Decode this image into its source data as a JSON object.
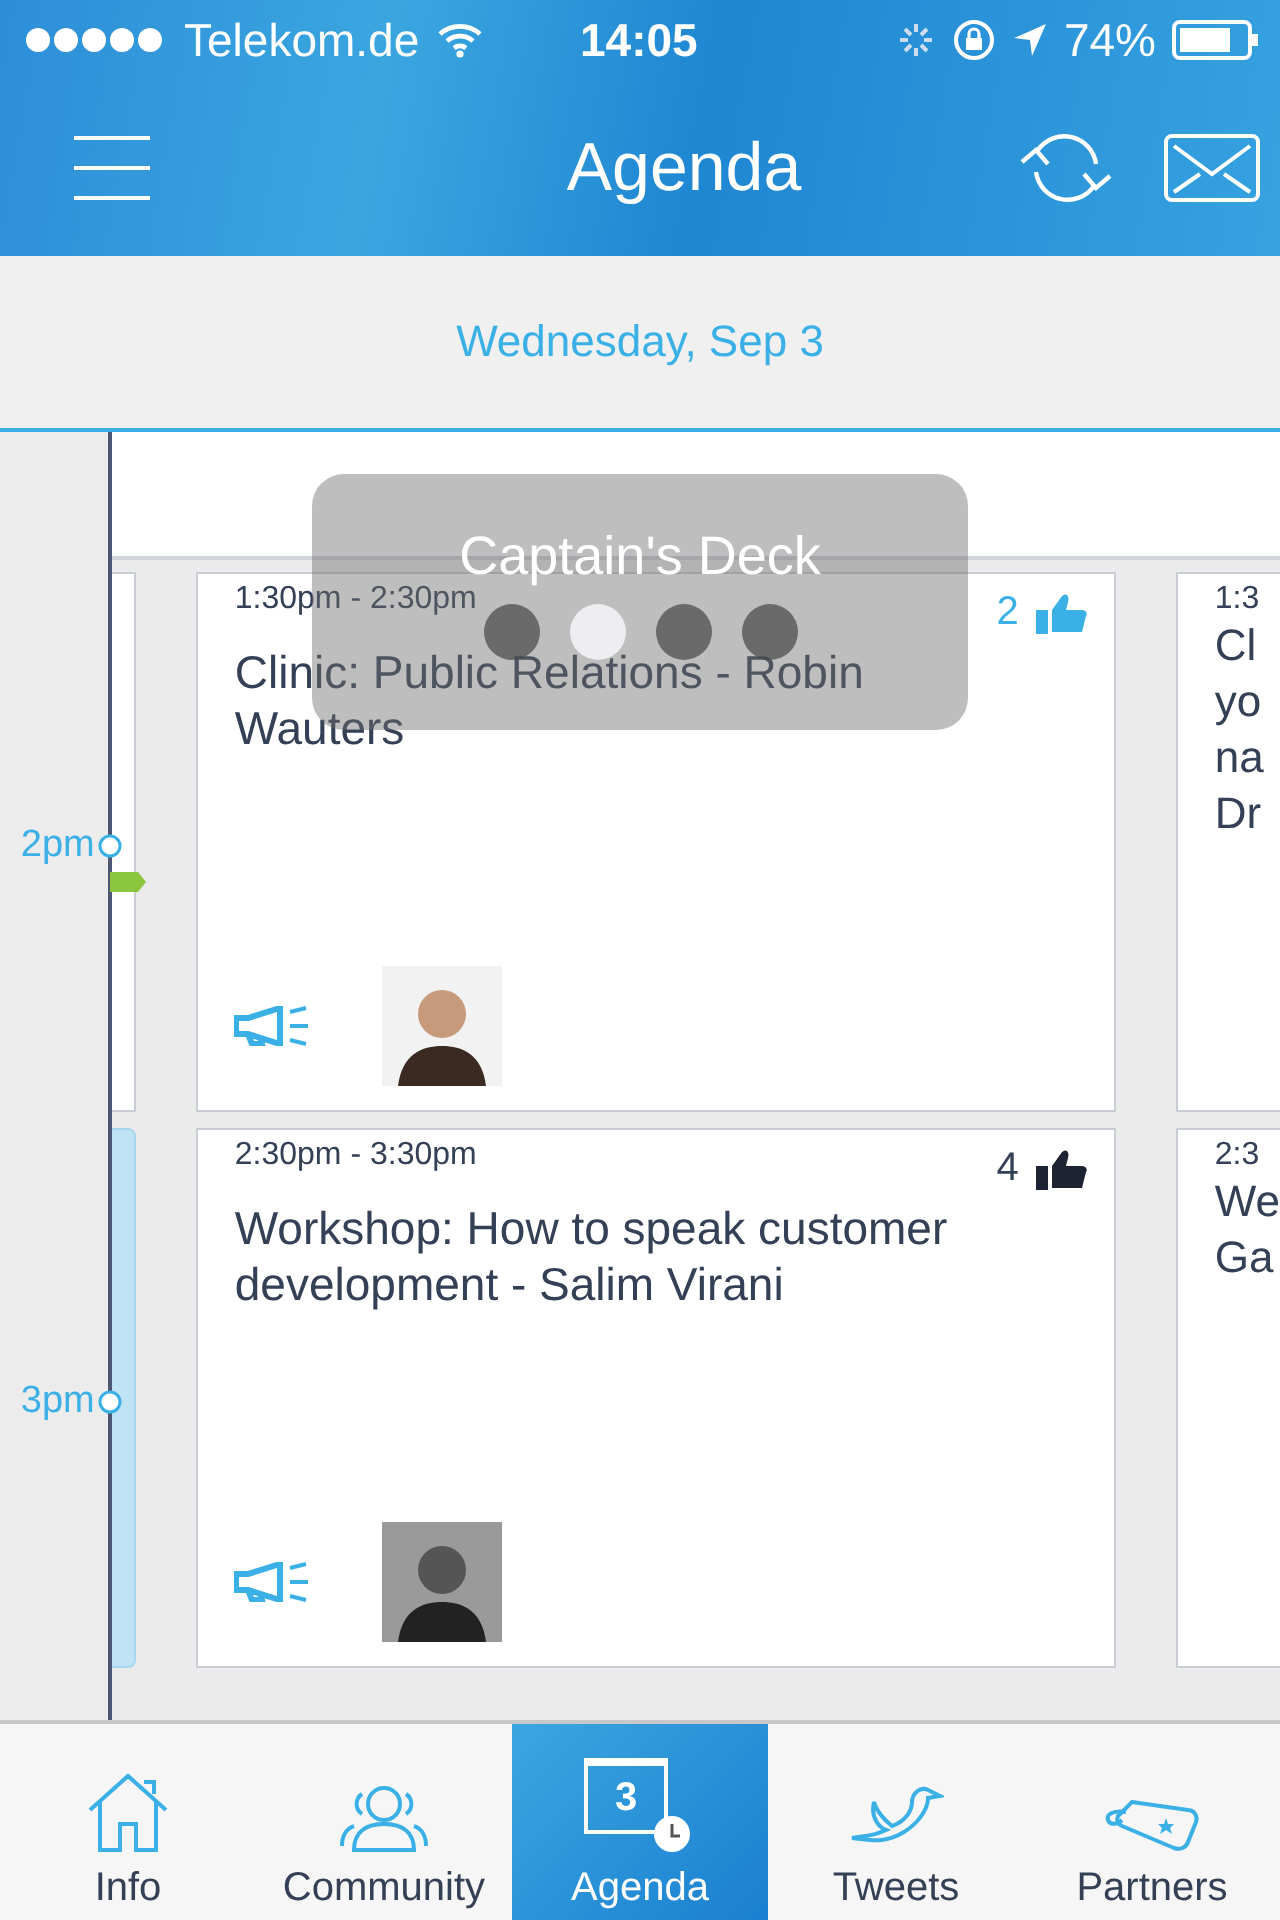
{
  "status_bar": {
    "carrier": "Telekom.de",
    "time": "14:05",
    "battery": "74%"
  },
  "nav": {
    "title": "Agenda"
  },
  "date": "Wednesday, Sep 3",
  "timeline": {
    "labels": [
      "2pm",
      "3pm"
    ]
  },
  "overlay": {
    "title": "Captain's Deck",
    "pages": [
      {
        "selected": false
      },
      {
        "selected": true
      },
      {
        "selected": false
      },
      {
        "selected": false
      }
    ]
  },
  "sessions": [
    {
      "time": "1:30pm - 2:30pm",
      "title": "Clinic: Public Relations - Robin Wauters",
      "likes": "2",
      "liked": true,
      "highlighted": false,
      "next": {
        "time": "1:3",
        "lines": [
          "Cl",
          "yo",
          "na",
          "Dr"
        ]
      }
    },
    {
      "time": "2:30pm - 3:30pm",
      "title": "Workshop: How to speak customer development - Salim Virani",
      "likes": "4",
      "liked": false,
      "highlighted": true,
      "next": {
        "time": "2:3",
        "lines": [
          "We",
          "Ga"
        ]
      }
    }
  ],
  "tabs": [
    {
      "label": "Info",
      "kind": "home",
      "selected": false
    },
    {
      "label": "Community",
      "kind": "people",
      "selected": false
    },
    {
      "label": "Agenda",
      "kind": "calendar",
      "selected": true,
      "badge": "3"
    },
    {
      "label": "Tweets",
      "kind": "bird",
      "selected": false
    },
    {
      "label": "Partners",
      "kind": "tag",
      "selected": false
    }
  ]
}
